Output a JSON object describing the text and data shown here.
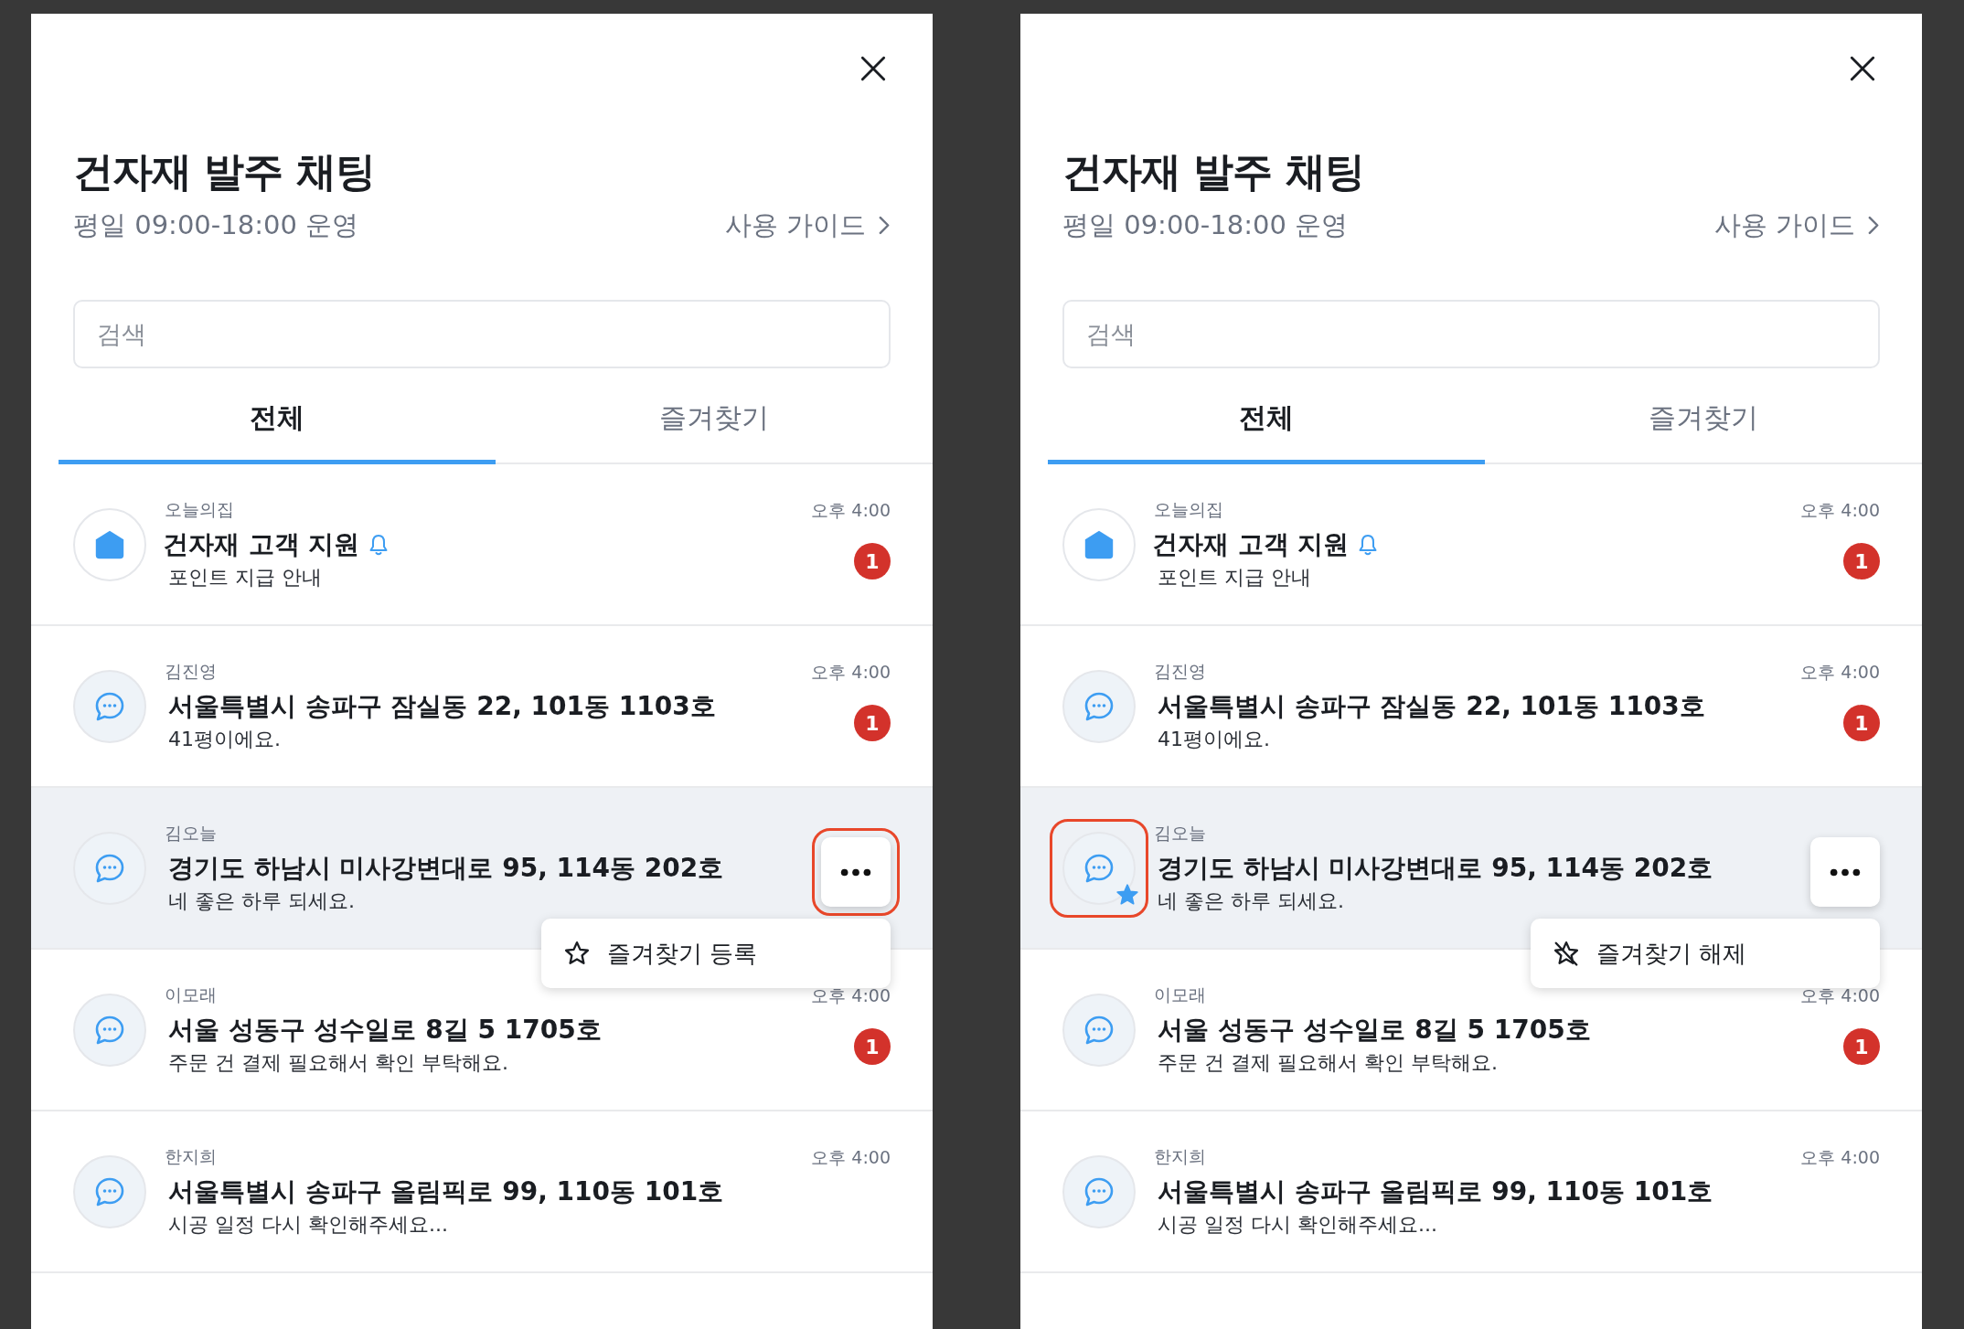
{
  "panels": [
    {
      "title": "건자재 발주 채팅",
      "hours": "평일 09:00-18:00 운영",
      "guide_link": "사용 가이드",
      "search": {
        "placeholder": "검색"
      },
      "tabs": [
        {
          "label": "전체",
          "selected": true
        },
        {
          "label": "즐겨찾기",
          "selected": false
        }
      ],
      "chats": [
        {
          "kind": "notice",
          "sender": "오늘의집",
          "title": "건자재 고객 지원",
          "bell": true,
          "preview": "포인트 지급 안내",
          "time": "오후 4:00",
          "unread": "1",
          "favorite": false,
          "selected": false
        },
        {
          "kind": "chat",
          "sender": "김진영",
          "title": "서울특별시 송파구 잠실동 22, 101동 1103호",
          "bell": false,
          "preview": "41평이에요.",
          "time": "오후 4:00",
          "unread": "1",
          "favorite": false,
          "selected": false
        },
        {
          "kind": "chat",
          "sender": "김오늘",
          "title": "경기도 하남시 미사강변대로 95, 114동 202호",
          "bell": false,
          "preview": "네 좋은 하루 되세요.",
          "favorite": false,
          "selected": true,
          "avatar_circled": false,
          "menu": {
            "kind": "add",
            "label": "즐겨찾기 등록",
            "button_circled": true
          }
        },
        {
          "kind": "chat",
          "sender": "이모래",
          "title": "서울 성동구 성수일로 8길 5 1705호",
          "bell": false,
          "preview": "주문 건 결제 필요해서 확인 부탁해요.",
          "time": "오후 4:00",
          "unread": "1",
          "favorite": false,
          "selected": false
        },
        {
          "kind": "chat",
          "sender": "한지희",
          "title": "서울특별시 송파구 올림픽로 99, 110동 101호",
          "bell": false,
          "preview": "시공 일정 다시 확인해주세요...",
          "time": "오후 4:00",
          "favorite": false,
          "selected": false
        }
      ]
    },
    {
      "title": "건자재 발주 채팅",
      "hours": "평일 09:00-18:00 운영",
      "guide_link": "사용 가이드",
      "search": {
        "placeholder": "검색"
      },
      "tabs": [
        {
          "label": "전체",
          "selected": true
        },
        {
          "label": "즐겨찾기",
          "selected": false
        }
      ],
      "chats": [
        {
          "kind": "notice",
          "sender": "오늘의집",
          "title": "건자재 고객 지원",
          "bell": true,
          "preview": "포인트 지급 안내",
          "time": "오후 4:00",
          "unread": "1",
          "favorite": false,
          "selected": false
        },
        {
          "kind": "chat",
          "sender": "김진영",
          "title": "서울특별시 송파구 잠실동 22, 101동 1103호",
          "bell": false,
          "preview": "41평이에요.",
          "time": "오후 4:00",
          "unread": "1",
          "favorite": false,
          "selected": false
        },
        {
          "kind": "chat",
          "sender": "김오늘",
          "title": "경기도 하남시 미사강변대로 95, 114동 202호",
          "bell": false,
          "preview": "네 좋은 하루 되세요.",
          "favorite": true,
          "selected": true,
          "avatar_circled": true,
          "menu": {
            "kind": "remove",
            "label": "즐겨찾기 해제",
            "button_circled": false
          }
        },
        {
          "kind": "chat",
          "sender": "이모래",
          "title": "서울 성동구 성수일로 8길 5 1705호",
          "bell": false,
          "preview": "주문 건 결제 필요해서 확인 부탁해요.",
          "time": "오후 4:00",
          "unread": "1",
          "favorite": false,
          "selected": false
        },
        {
          "kind": "chat",
          "sender": "한지희",
          "title": "서울특별시 송파구 올림픽로 99, 110동 101호",
          "bell": false,
          "preview": "시공 일정 다시 확인해주세요...",
          "time": "오후 4:00",
          "favorite": false,
          "selected": false
        }
      ]
    }
  ]
}
